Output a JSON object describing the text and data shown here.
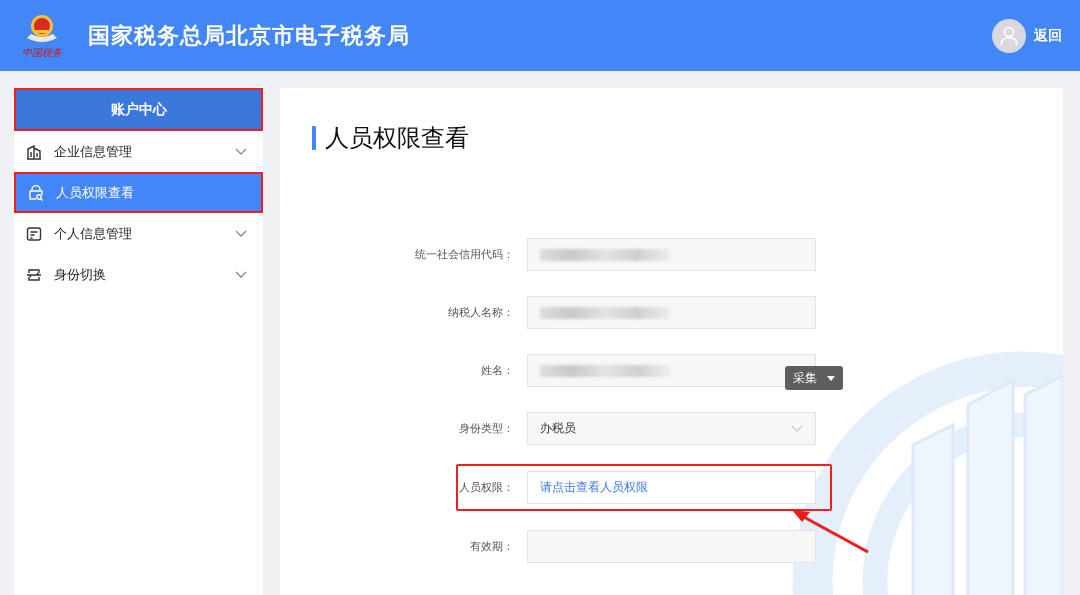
{
  "header": {
    "logo_caption": "中国税务",
    "title": "国家税务总局北京市电子税务局",
    "back": "返回"
  },
  "sidebar": {
    "heading": {
      "label": "账户中心",
      "highlighted": true
    },
    "items": [
      {
        "label": "企业信息管理",
        "selected": false,
        "expandable": true,
        "highlighted": false
      },
      {
        "label": "人员权限查看",
        "selected": true,
        "expandable": false,
        "highlighted": true
      },
      {
        "label": "个人信息管理",
        "selected": false,
        "expandable": true,
        "highlighted": false
      },
      {
        "label": "身份切换",
        "selected": false,
        "expandable": true,
        "highlighted": false
      }
    ]
  },
  "page": {
    "title": "人员权限查看",
    "fields": [
      {
        "label": "统一社会信用代码：",
        "kind": "redacted",
        "highlighted": false
      },
      {
        "label": "纳税人名称：",
        "kind": "redacted",
        "highlighted": false
      },
      {
        "label": "姓名：",
        "kind": "redacted",
        "highlighted": false
      },
      {
        "label": "身份类型：",
        "kind": "select",
        "value": "办税员",
        "highlighted": false
      },
      {
        "label": "人员权限：",
        "kind": "link",
        "value": "请点击查看人员权限",
        "highlighted": true
      },
      {
        "label": "有效期：",
        "kind": "empty",
        "highlighted": false
      }
    ],
    "capture_menu": {
      "label": "采集"
    },
    "annotation_arrow": true
  }
}
